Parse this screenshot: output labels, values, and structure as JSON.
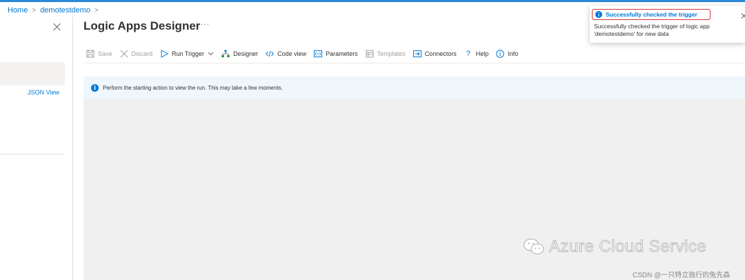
{
  "breadcrumb": {
    "home": "Home",
    "app": "demotestdemo"
  },
  "left_panel": {
    "json_view_label": "JSON View"
  },
  "header": {
    "title": "Logic Apps Designer",
    "more": "···"
  },
  "toolbar": {
    "save": "Save",
    "discard": "Discard",
    "run_trigger": "Run Trigger",
    "designer": "Designer",
    "code_view": "Code view",
    "parameters": "Parameters",
    "templates": "Templates",
    "connectors": "Connectors",
    "help": "Help",
    "info": "Info"
  },
  "info_bar": {
    "message": "Perform the starting action to view the run. This may take a few moments."
  },
  "toast": {
    "title": "Successfully checked the trigger",
    "body_line1": "Successfully checked the trigger of logic app",
    "body_line2": "'demotestdemo' for new data"
  },
  "watermark": {
    "main": "Azure Cloud Service",
    "sub": "CSDN @一只特立独行的兔先森"
  },
  "colors": {
    "accent": "#0078d4",
    "highlight": "#d13438",
    "topbar": "#2b88d8",
    "canvas": "#f0f0f0",
    "infobar": "#eff6fc"
  }
}
